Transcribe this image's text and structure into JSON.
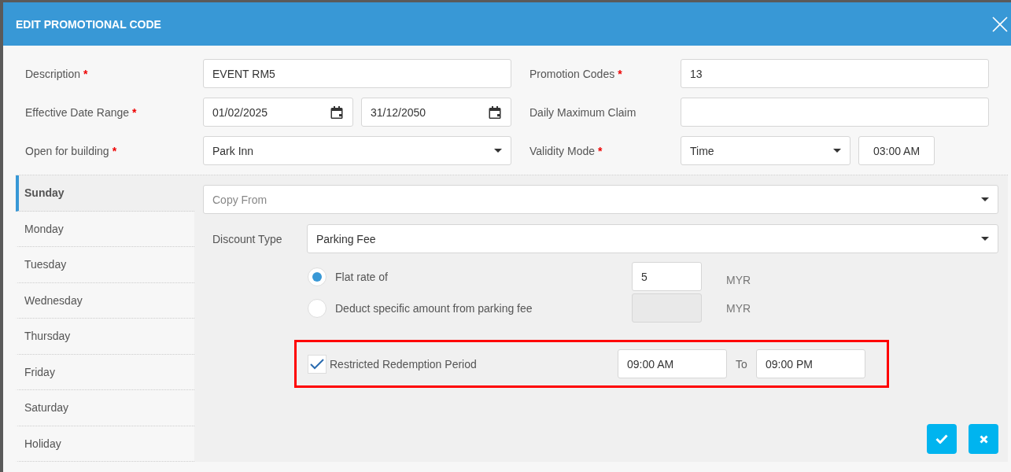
{
  "dialog": {
    "title": "EDIT PROMOTIONAL CODE"
  },
  "form_rows": [
    {
      "left": {
        "label": "Description",
        "mark": "*",
        "controls": [
          {
            "kind": "text",
            "value": "EVENT RM5"
          }
        ]
      },
      "right": {
        "label": "Promotion Codes",
        "mark": "*",
        "controls": [
          {
            "kind": "text",
            "value": "13"
          }
        ]
      }
    },
    {
      "left": {
        "label": "Effective Date Range",
        "mark": "*",
        "controls": [
          {
            "kind": "date",
            "value": "01/02/2025"
          },
          {
            "kind": "date",
            "value": "31/12/2050"
          }
        ]
      },
      "right": {
        "label": "Daily Maximum Claim",
        "controls": [
          {
            "kind": "text"
          }
        ]
      }
    },
    {
      "left": {
        "label": "Open for building",
        "mark": "*",
        "controls": [
          {
            "kind": "select",
            "value": "Park Inn"
          }
        ]
      },
      "right": {
        "label": "Validity Mode",
        "mark": "*",
        "controls": [
          {
            "kind": "select",
            "value": "Time"
          },
          {
            "kind": "time",
            "value": "03:00 AM"
          }
        ]
      }
    }
  ],
  "days": [
    {
      "label": "Sunday",
      "selected": true
    },
    {
      "label": "Monday",
      "selected": false
    },
    {
      "label": "Tuesday",
      "selected": false
    },
    {
      "label": "Wednesday",
      "selected": false
    },
    {
      "label": "Thursday",
      "selected": false
    },
    {
      "label": "Friday",
      "selected": false
    },
    {
      "label": "Saturday",
      "selected": false
    },
    {
      "label": "Holiday",
      "selected": false
    }
  ],
  "copy_from": {
    "placeholder": "Copy From"
  },
  "discount_type": {
    "label": "Discount Type",
    "value": "Parking Fee"
  },
  "discount_options": [
    {
      "label": "Flat rate of",
      "selected": true,
      "amount": "5",
      "currency": "MYR",
      "disabled": false
    },
    {
      "label": "Deduct specific amount from parking fee",
      "selected": false,
      "currency": "MYR",
      "disabled": true
    }
  ],
  "restricted_period": {
    "label": "Restricted Redemption Period",
    "checked": true,
    "highlighted": true,
    "from": "09:00 AM",
    "to_label": "To",
    "to": "09:00 PM"
  },
  "buttons": [
    {
      "kind": "confirm"
    },
    {
      "kind": "cancel"
    }
  ]
}
